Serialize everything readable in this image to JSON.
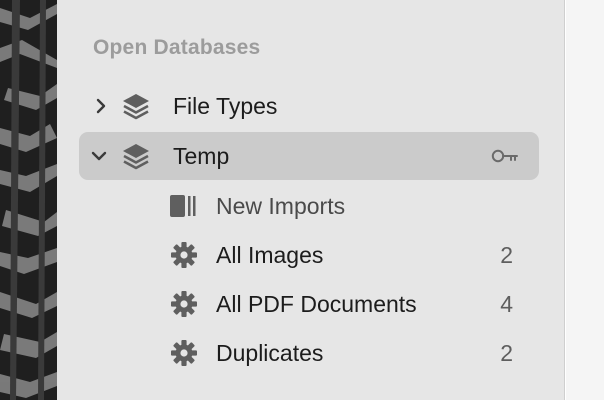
{
  "sidebar": {
    "section_title": "Open Databases",
    "databases": [
      {
        "label": "File Types",
        "expanded": false,
        "selected": false,
        "icon": "stack-icon"
      },
      {
        "label": "Temp",
        "expanded": true,
        "selected": true,
        "icon": "stack-icon",
        "badge_icon": "key-icon"
      }
    ],
    "groups": [
      {
        "label": "New Imports",
        "count": "",
        "icon": "inbox-icon"
      },
      {
        "label": "All Images",
        "count": "2",
        "icon": "gear-icon"
      },
      {
        "label": "All PDF Documents",
        "count": "4",
        "icon": "gear-icon"
      },
      {
        "label": "Duplicates",
        "count": "2",
        "icon": "gear-icon"
      }
    ]
  },
  "colors": {
    "sidebar_bg": "#e6e6e6",
    "selection_bg": "#cbcbcb",
    "header_text": "#9c9c9c",
    "icon_gray": "#5f5f5f"
  }
}
